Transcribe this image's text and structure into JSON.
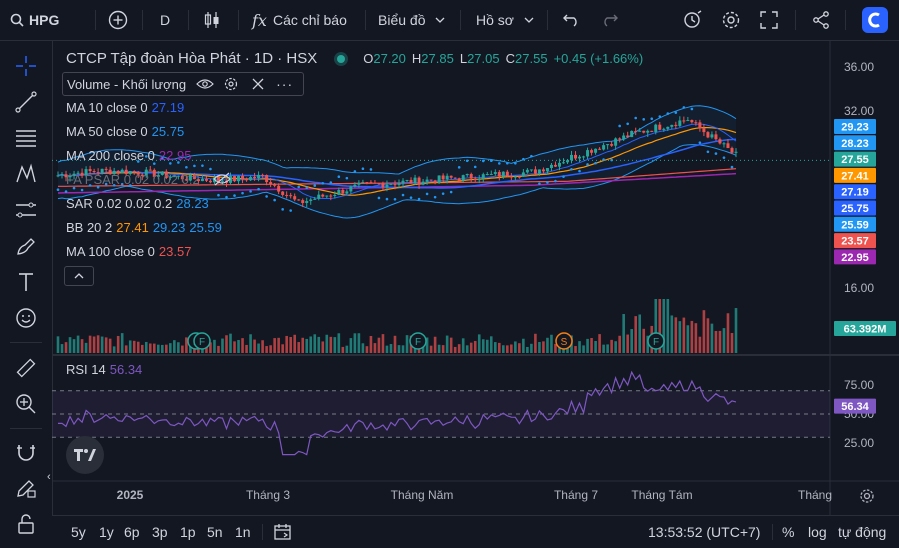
{
  "toolbar": {
    "symbol": "HPG",
    "interval": "D",
    "indicators_label": "Các chỉ báo",
    "chart_label": "Biểu đồ",
    "profile_label": "Hồ sơ"
  },
  "header": {
    "title": "CTCP Tập đoàn Hòa Phát · 1D · HSX",
    "o_label": "O",
    "o_value": "27.20",
    "h_label": "H",
    "h_value": "27.85",
    "l_label": "L",
    "l_value": "27.05",
    "c_label": "C",
    "c_value": "27.55",
    "change": "+0.45 (+1.66%)"
  },
  "legend": {
    "volume": "Volume - Khối lượng",
    "ma10_label": "MA 10 close 0",
    "ma10_value": "27.19",
    "ma50_label": "MA 50 close 0",
    "ma50_value": "25.75",
    "ma200_label": "MA 200 close 0",
    "ma200_value": "22.95",
    "psar_label": "FA PSAR 0.02 0.02 0.2",
    "sar_label": "SAR 0.02 0.02 0.2",
    "sar_value": "28.23",
    "bb_label": "BB 20 2",
    "bb_v1": "27.41",
    "bb_v2": "29.23",
    "bb_v3": "25.59",
    "ma100_label": "MA 100 close 0",
    "ma100_value": "23.57"
  },
  "rsi": {
    "label": "RSI 14",
    "value": "56.34"
  },
  "bottom": {
    "ranges": [
      "5y",
      "1y",
      "6p",
      "3p",
      "1p",
      "5n",
      "1n"
    ],
    "time": "13:53:52 (UTC+7)",
    "pct": "%",
    "log": "log",
    "auto": "tự động"
  },
  "colors": {
    "up": "#26a69a",
    "down": "#ef5350",
    "ma10": "#2962ff",
    "ma50": "#ff9800",
    "ma200": "#9c27b0",
    "ma100": "#ef5350",
    "bb": "#2196f3",
    "rsi": "#7e57c2"
  },
  "chart_data": {
    "type": "candlestick",
    "price_axis_ticks": [
      "36.00",
      "32.00",
      "16.00"
    ],
    "price_axis_ylim": [
      16,
      36
    ],
    "price_labels": [
      {
        "value": "29.23",
        "color": "#2196f3"
      },
      {
        "value": "28.23",
        "color": "#2196f3"
      },
      {
        "value": "27.55",
        "color": "#26a69a"
      },
      {
        "value": "27.41",
        "color": "#ff9800"
      },
      {
        "value": "27.19",
        "color": "#2962ff"
      },
      {
        "value": "25.75",
        "color": "#2962ff"
      },
      {
        "value": "25.59",
        "color": "#2196f3"
      },
      {
        "value": "23.57",
        "color": "#ef5350"
      },
      {
        "value": "22.95",
        "color": "#9c27b0"
      }
    ],
    "volume_label": "63.392M",
    "rsi_ticks": [
      "75.00",
      "50.00",
      "25.00"
    ],
    "rsi_current": "56.34",
    "x_ticks": [
      "2025",
      "Tháng 3",
      "Tháng Năm",
      "Tháng 7",
      "Tháng Tám",
      "Tháng"
    ],
    "events": [
      "F",
      "F",
      "F",
      "S",
      "F"
    ],
    "ohlc_last": {
      "open": 27.2,
      "high": 27.85,
      "low": 27.05,
      "close": 27.55
    }
  }
}
